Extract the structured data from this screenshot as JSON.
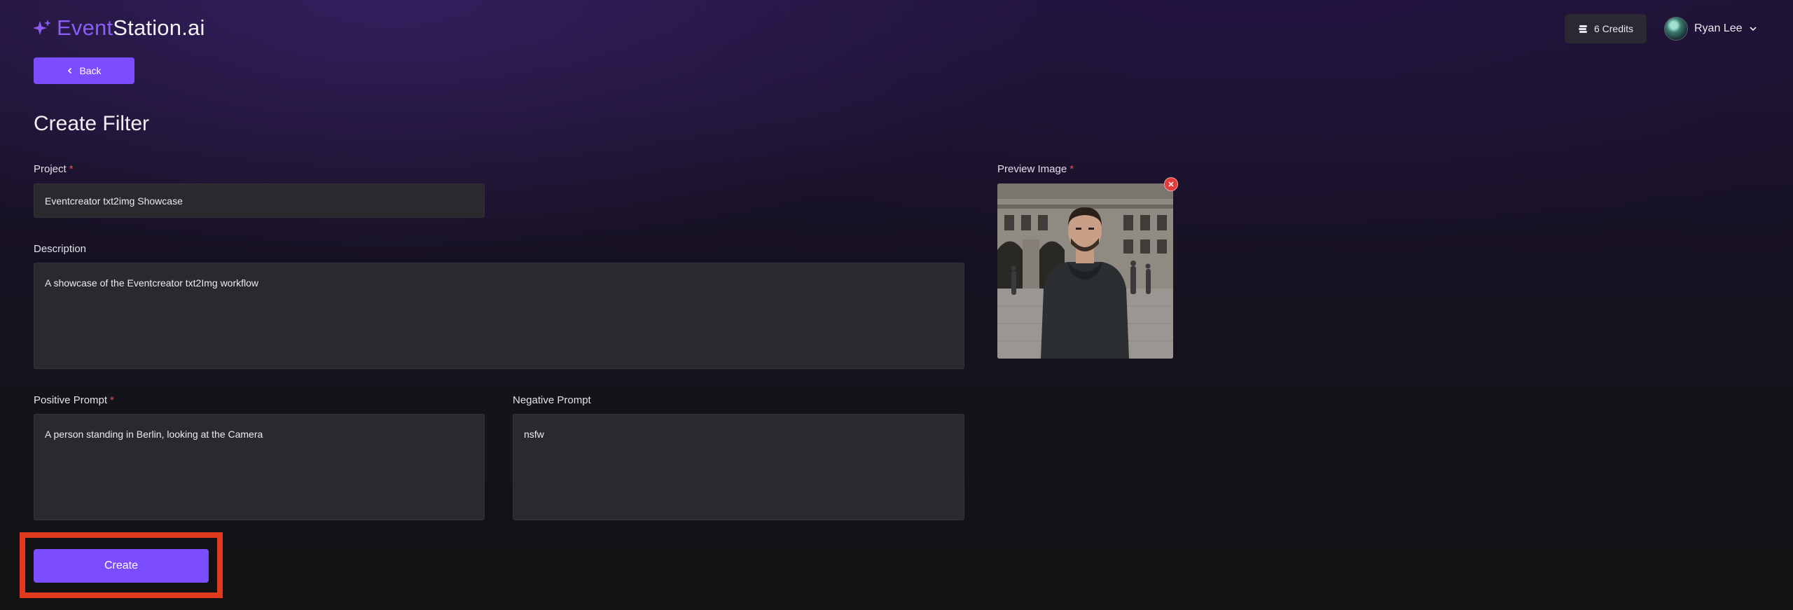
{
  "app": {
    "logo_part1": "Event",
    "logo_part2": "Station.ai",
    "accent_color": "#7c4dff"
  },
  "header": {
    "credits_label": "6 Credits",
    "user_name": "Ryan Lee"
  },
  "nav": {
    "back_label": "Back"
  },
  "page": {
    "title": "Create Filter"
  },
  "form": {
    "project": {
      "label": "Project",
      "required": "*",
      "value": "Eventcreator txt2img Showcase"
    },
    "description": {
      "label": "Description",
      "value": "A showcase of the Eventcreator txt2Img workflow"
    },
    "positive_prompt": {
      "label": "Positive Prompt",
      "required": "*",
      "value": "A person standing in Berlin, looking at the Camera"
    },
    "negative_prompt": {
      "label": "Negative Prompt",
      "value": "nsfw"
    },
    "preview_image": {
      "label": "Preview Image",
      "required": "*"
    },
    "submit_label": "Create"
  },
  "icons": {
    "logo": "sparkle-icon",
    "credits": "coins-stack-icon",
    "user_menu": "chevron-down-icon",
    "back": "chevron-left-icon",
    "remove_image": "close-icon"
  }
}
